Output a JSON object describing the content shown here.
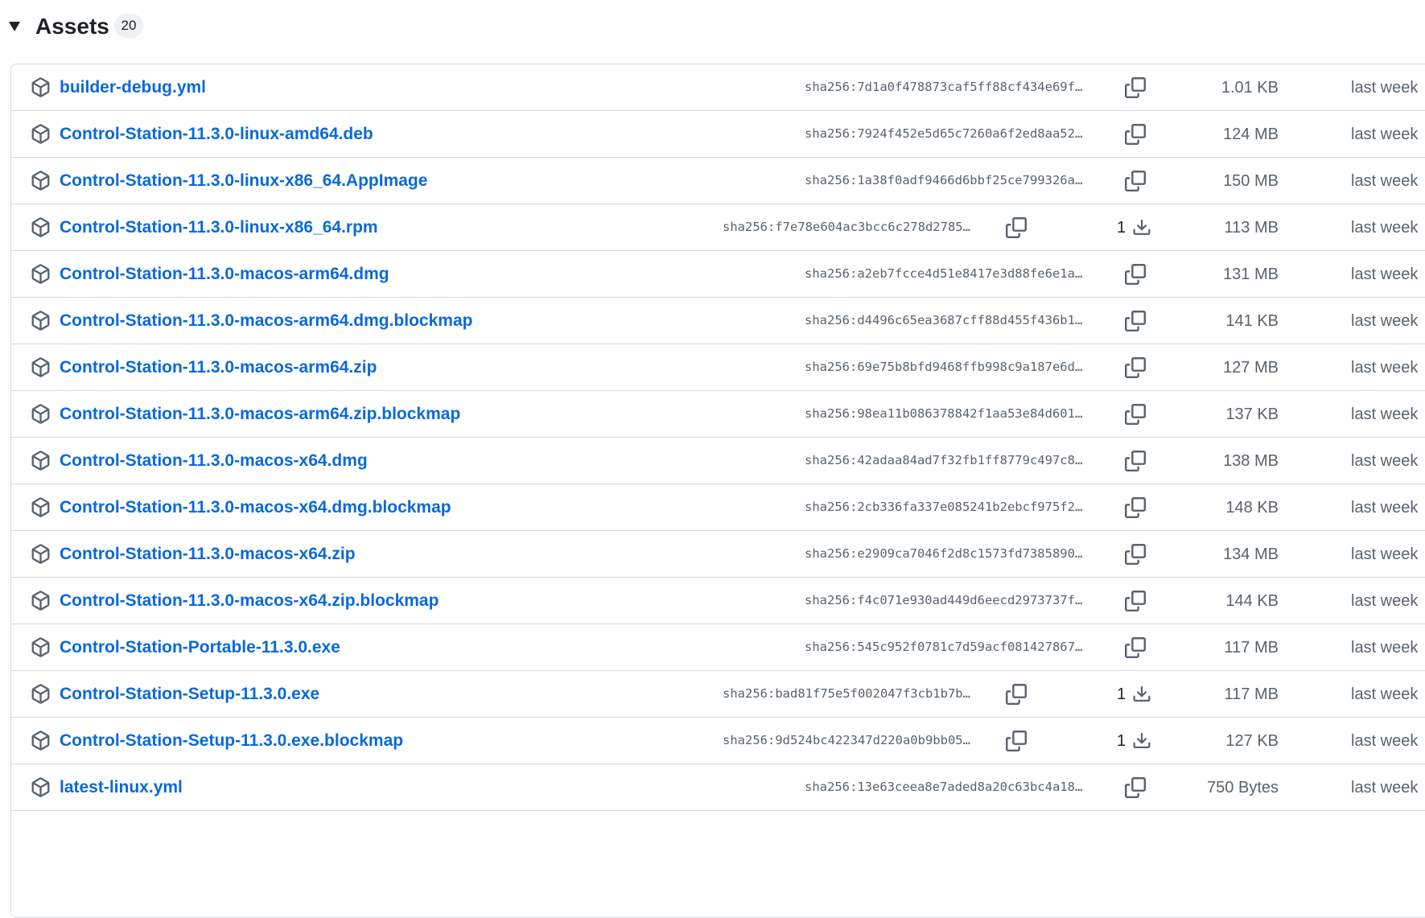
{
  "assets": {
    "title": "Assets",
    "count": "20",
    "items": [
      {
        "name": "builder-debug.yml",
        "sha": "sha256:7d1a0f478873caf5ff88cf434e69f…",
        "downloads": "",
        "size": "1.01 KB",
        "date": "last week"
      },
      {
        "name": "Control-Station-11.3.0-linux-amd64.deb",
        "sha": "sha256:7924f452e5d65c7260a6f2ed8aa52…",
        "downloads": "",
        "size": "124 MB",
        "date": "last week"
      },
      {
        "name": "Control-Station-11.3.0-linux-x86_64.AppImage",
        "sha": "sha256:1a38f0adf9466d6bbf25ce799326a…",
        "downloads": "",
        "size": "150 MB",
        "date": "last week"
      },
      {
        "name": "Control-Station-11.3.0-linux-x86_64.rpm",
        "sha": "sha256:f7e78e604ac3bcc6c278d2785…",
        "downloads": "1",
        "size": "113 MB",
        "date": "last week"
      },
      {
        "name": "Control-Station-11.3.0-macos-arm64.dmg",
        "sha": "sha256:a2eb7fcce4d51e8417e3d88fe6e1a…",
        "downloads": "",
        "size": "131 MB",
        "date": "last week"
      },
      {
        "name": "Control-Station-11.3.0-macos-arm64.dmg.blockmap",
        "sha": "sha256:d4496c65ea3687cff88d455f436b1…",
        "downloads": "",
        "size": "141 KB",
        "date": "last week"
      },
      {
        "name": "Control-Station-11.3.0-macos-arm64.zip",
        "sha": "sha256:69e75b8bfd9468ffb998c9a187e6d…",
        "downloads": "",
        "size": "127 MB",
        "date": "last week"
      },
      {
        "name": "Control-Station-11.3.0-macos-arm64.zip.blockmap",
        "sha": "sha256:98ea11b086378842f1aa53e84d601…",
        "downloads": "",
        "size": "137 KB",
        "date": "last week"
      },
      {
        "name": "Control-Station-11.3.0-macos-x64.dmg",
        "sha": "sha256:42adaa84ad7f32fb1ff8779c497c8…",
        "downloads": "",
        "size": "138 MB",
        "date": "last week"
      },
      {
        "name": "Control-Station-11.3.0-macos-x64.dmg.blockmap",
        "sha": "sha256:2cb336fa337e085241b2ebcf975f2…",
        "downloads": "",
        "size": "148 KB",
        "date": "last week"
      },
      {
        "name": "Control-Station-11.3.0-macos-x64.zip",
        "sha": "sha256:e2909ca7046f2d8c1573fd7385890…",
        "downloads": "",
        "size": "134 MB",
        "date": "last week"
      },
      {
        "name": "Control-Station-11.3.0-macos-x64.zip.blockmap",
        "sha": "sha256:f4c071e930ad449d6eecd2973737f…",
        "downloads": "",
        "size": "144 KB",
        "date": "last week"
      },
      {
        "name": "Control-Station-Portable-11.3.0.exe",
        "sha": "sha256:545c952f0781c7d59acf081427867…",
        "downloads": "",
        "size": "117 MB",
        "date": "last week"
      },
      {
        "name": "Control-Station-Setup-11.3.0.exe",
        "sha": "sha256:bad81f75e5f002047f3cb1b7b…",
        "downloads": "1",
        "size": "117 MB",
        "date": "last week"
      },
      {
        "name": "Control-Station-Setup-11.3.0.exe.blockmap",
        "sha": "sha256:9d524bc422347d220a0b9bb05…",
        "downloads": "1",
        "size": "127 KB",
        "date": "last week"
      },
      {
        "name": "latest-linux.yml",
        "sha": "sha256:13e63ceea8e7aded8a20c63bc4a18…",
        "downloads": "",
        "size": "750 Bytes",
        "date": "last week"
      }
    ]
  },
  "icons": {
    "caret": "triangle-down-icon",
    "asset": "package-icon",
    "copy": "copy-icon",
    "download": "download-icon"
  },
  "colors": {
    "link": "#0969da",
    "muted": "#59636e",
    "border": "#d1d9e0",
    "text": "#1f2328"
  }
}
